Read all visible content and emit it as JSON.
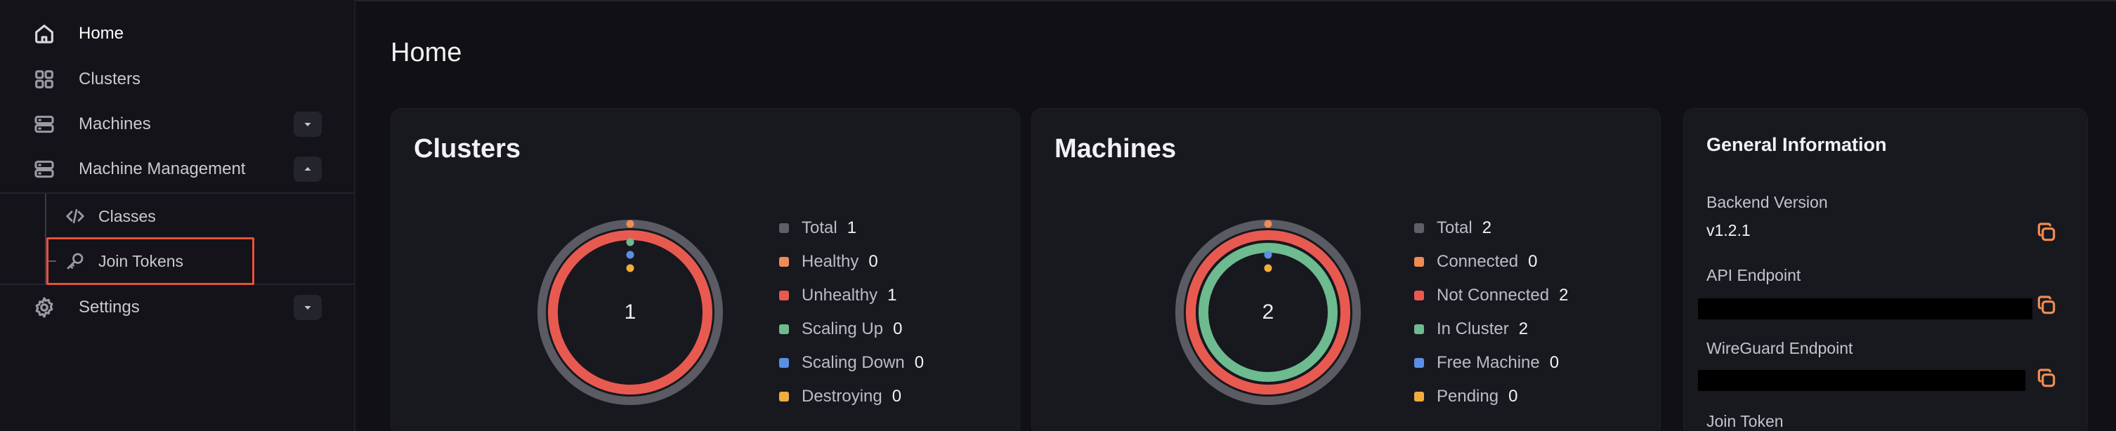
{
  "sidebar": {
    "items": [
      {
        "label": "Home",
        "icon": "home-icon"
      },
      {
        "label": "Clusters",
        "icon": "grid-icon"
      },
      {
        "label": "Machines",
        "icon": "server-icon"
      },
      {
        "label": "Machine Management",
        "icon": "server-icon"
      },
      {
        "label": "Settings",
        "icon": "gear-icon"
      }
    ],
    "sub_items": [
      {
        "label": "Classes",
        "icon": "code-icon"
      },
      {
        "label": "Join Tokens",
        "icon": "key-icon"
      }
    ],
    "highlight_color": "#e8503a"
  },
  "page": {
    "title": "Home"
  },
  "clusters_card": {
    "title": "Clusters",
    "center_value": "1",
    "legend": [
      {
        "label": "Total",
        "value": "1",
        "color": "#5f5f68"
      },
      {
        "label": "Healthy",
        "value": "0",
        "color": "#ef8b55"
      },
      {
        "label": "Unhealthy",
        "value": "1",
        "color": "#e85a50"
      },
      {
        "label": "Scaling Up",
        "value": "0",
        "color": "#6dbb8f"
      },
      {
        "label": "Scaling Down",
        "value": "0",
        "color": "#5b8fe6"
      },
      {
        "label": "Destroying",
        "value": "0",
        "color": "#f0ad3c"
      }
    ]
  },
  "machines_card": {
    "title": "Machines",
    "center_value": "2",
    "legend": [
      {
        "label": "Total",
        "value": "2",
        "color": "#5f5f68"
      },
      {
        "label": "Connected",
        "value": "0",
        "color": "#ef8b55"
      },
      {
        "label": "Not Connected",
        "value": "2",
        "color": "#e85a50"
      },
      {
        "label": "In Cluster",
        "value": "2",
        "color": "#6dbb8f"
      },
      {
        "label": "Free Machine",
        "value": "0",
        "color": "#5b8fe6"
      },
      {
        "label": "Pending",
        "value": "0",
        "color": "#f0ad3c"
      }
    ]
  },
  "general_info": {
    "title": "General Information",
    "backend_version_label": "Backend Version",
    "backend_version_value": "v1.2.1",
    "api_endpoint_label": "API Endpoint",
    "wireguard_endpoint_label": "WireGuard Endpoint",
    "join_token_label": "Join Token"
  }
}
